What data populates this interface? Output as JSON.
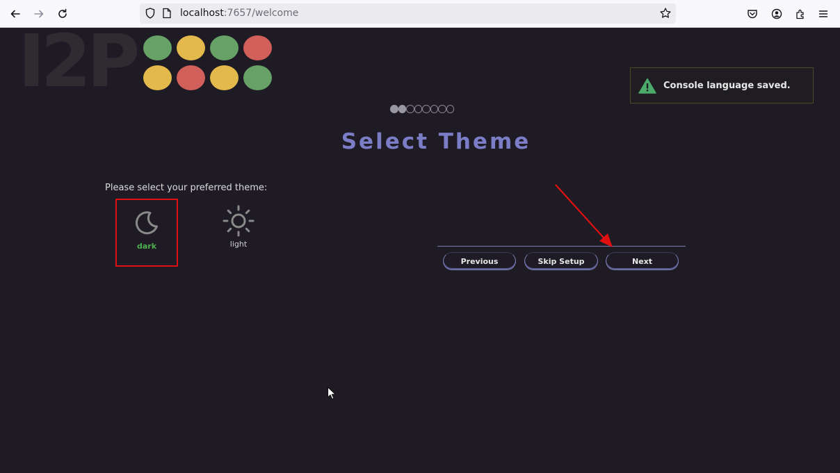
{
  "browser": {
    "url_host": "localhost",
    "url_rest": ":7657/welcome",
    "icons": [
      "back-icon",
      "forward-icon",
      "reload-icon",
      "shield-icon",
      "page-icon",
      "star-icon",
      "pocket-icon",
      "account-icon",
      "extensions-icon",
      "menu-icon"
    ]
  },
  "logo": {
    "text": "I2P",
    "dot_colors": [
      "#66a266",
      "#e3b94c",
      "#66a266",
      "#d2605a",
      "#e3b94c",
      "#d2605a",
      "#e3b94c",
      "#66a266"
    ]
  },
  "progress": {
    "current": 2,
    "total": 8
  },
  "notice": {
    "message": "Console language saved.",
    "icon": "warning-icon"
  },
  "page": {
    "title": "Select Theme",
    "prompt": "Please select your preferred theme:"
  },
  "themes": [
    {
      "label": "dark",
      "icon": "moon-icon",
      "selected": true
    },
    {
      "label": "light",
      "icon": "sun-icon",
      "selected": false
    }
  ],
  "buttons": {
    "previous": "Previous",
    "skip": "Skip Setup",
    "next": "Next"
  },
  "colors": {
    "title": "#7b7ec7",
    "selected_border": "#e01010",
    "annotation_arrow": "#e01010",
    "dark_label": "#4fae4f"
  }
}
